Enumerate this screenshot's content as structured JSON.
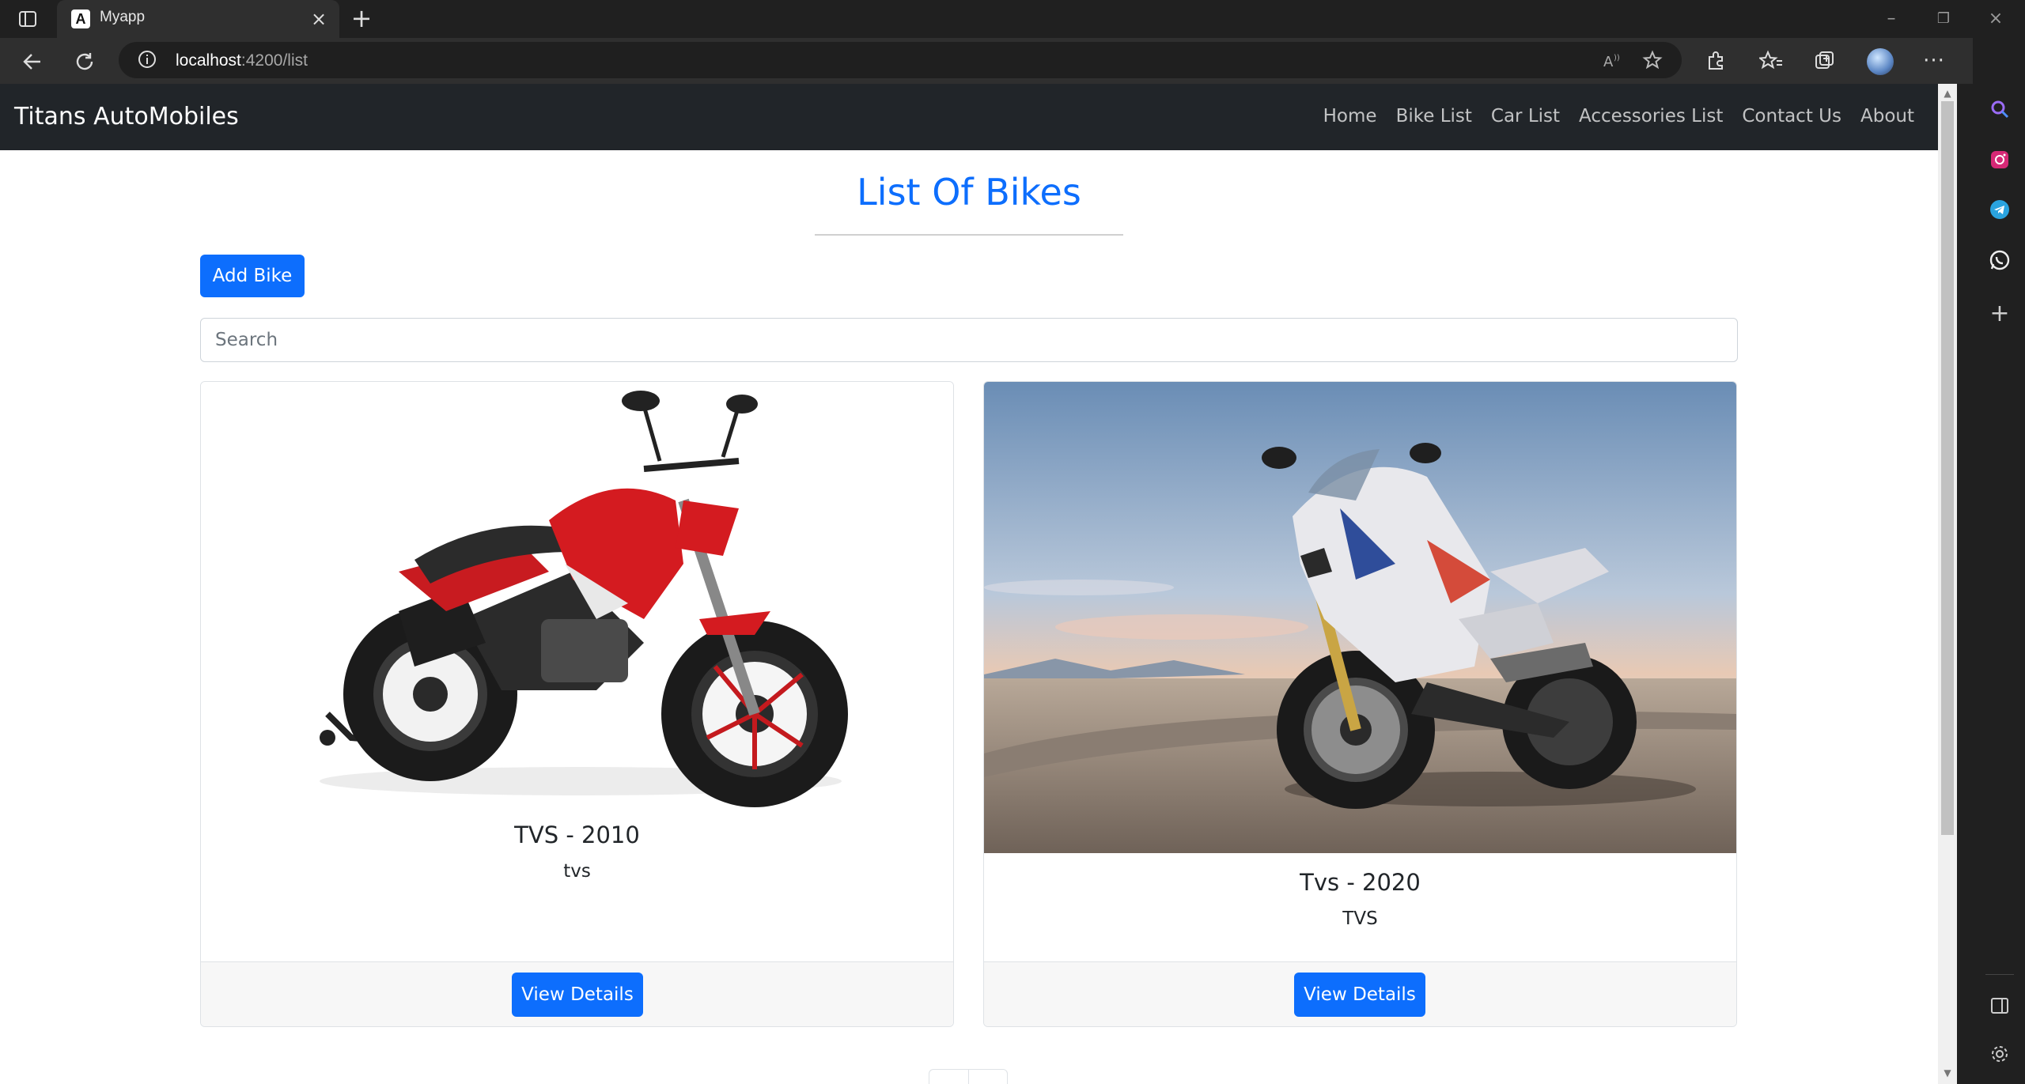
{
  "browser": {
    "tab_title": "Myapp",
    "tab_favicon_letter": "A",
    "url_host": "localhost",
    "url_path": ":4200/list"
  },
  "navbar": {
    "brand": "Titans AutoMobiles",
    "links": [
      "Home",
      "Bike List",
      "Car List",
      "Accessories List",
      "Contact Us",
      "About"
    ]
  },
  "page": {
    "title": "List Of Bikes",
    "add_button": "Add Bike",
    "search_placeholder": "Search"
  },
  "cards": [
    {
      "title": "TVS - 2010",
      "text": "tvs",
      "button": "View Details"
    },
    {
      "title": "Tvs - 2020",
      "text": "TVS",
      "button": "View Details"
    }
  ],
  "colors": {
    "primary": "#0d6efd",
    "navbar": "#212529",
    "bike1_body": "#d41b20",
    "bike2_body": "#e8e8ec"
  }
}
